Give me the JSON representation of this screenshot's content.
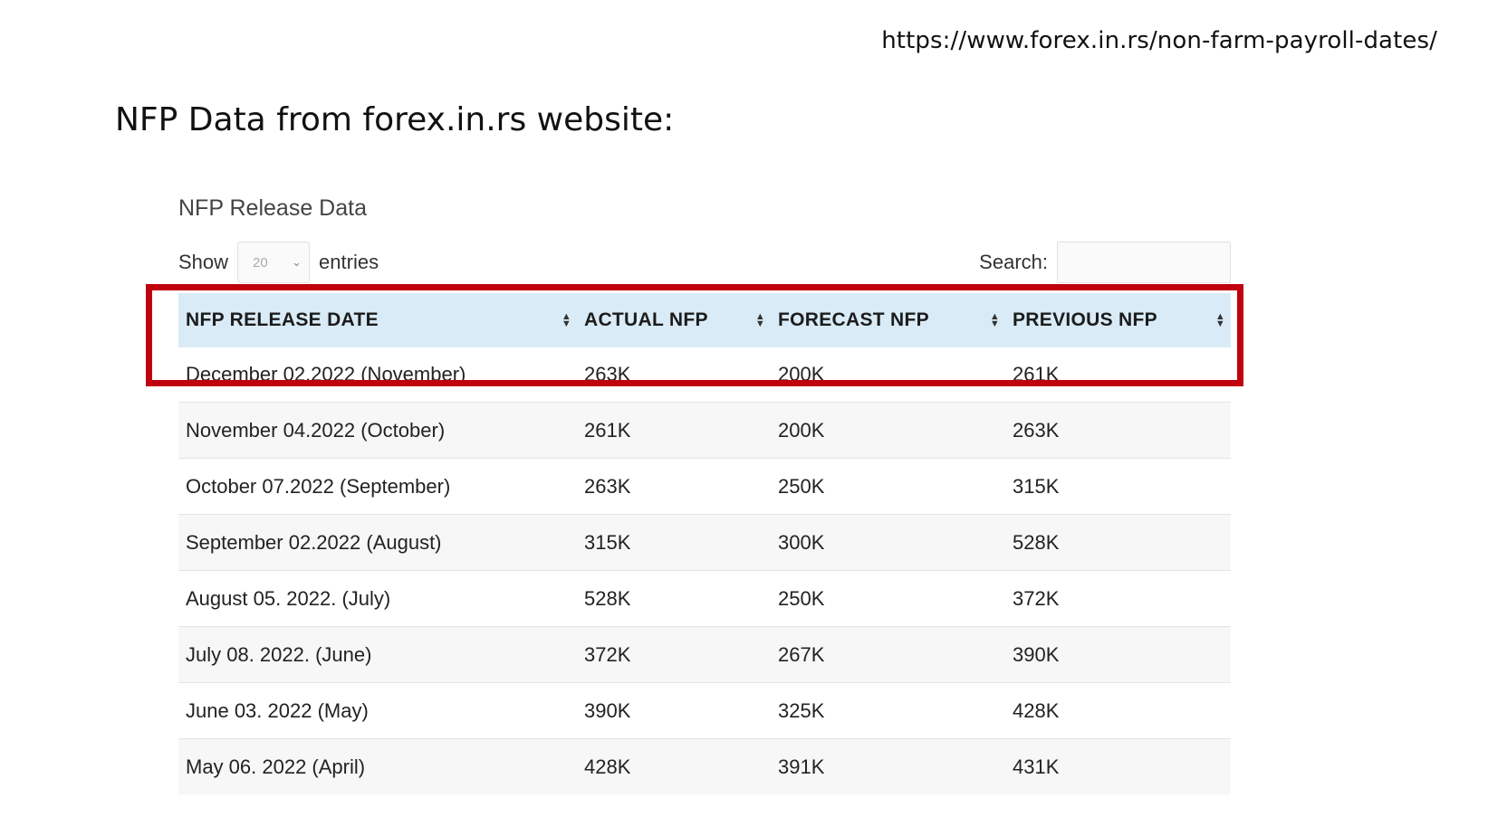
{
  "header": {
    "url": "https://www.forex.in.rs/non-farm-payroll-dates/",
    "slide_title": "NFP Data from forex.in.rs website:"
  },
  "panel": {
    "title": "NFP Release Data",
    "show_label": "Show",
    "entries_value": "20",
    "entries_label": "entries",
    "search_label": "Search:"
  },
  "table": {
    "columns": [
      "NFP RELEASE DATE",
      "ACTUAL NFP",
      "FORECAST NFP",
      "PREVIOUS NFP"
    ],
    "rows": [
      [
        "December 02.2022 (November)",
        "263K",
        "200K",
        "261K"
      ],
      [
        "November 04.2022 (October)",
        "261K",
        "200K",
        "263K"
      ],
      [
        "October 07.2022 (September)",
        "263K",
        "250K",
        "315K"
      ],
      [
        "September 02.2022 (August)",
        "315K",
        "300K",
        "528K"
      ],
      [
        "August 05. 2022. (July)",
        "528K",
        "250K",
        "372K"
      ],
      [
        "July 08. 2022. (June)",
        "372K",
        "267K",
        "390K"
      ],
      [
        "June 03. 2022 (May)",
        "390K",
        "325K",
        "428K"
      ],
      [
        "May 06. 2022 (April)",
        "428K",
        "391K",
        "431K"
      ]
    ]
  },
  "colors": {
    "header_bg": "#d9ebf6",
    "highlight": "#c0000c",
    "row_alt": "#f7f7f7"
  }
}
